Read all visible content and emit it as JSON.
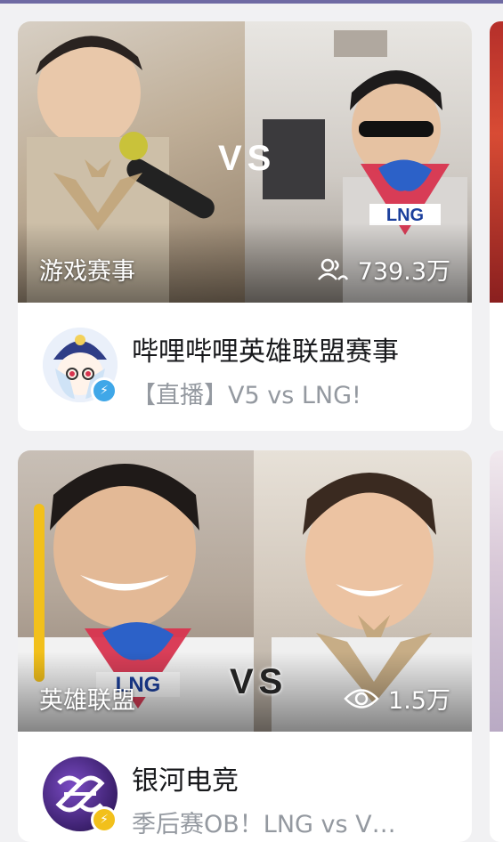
{
  "cards": [
    {
      "category": "游戏赛事",
      "viewers": "739.3万",
      "vs_text": "VS",
      "title": "哔哩哔哩英雄联盟赛事",
      "subtitle": "【直播】V5 vs LNG!",
      "viewer_icon": "people-icon",
      "badge_icon": "lightning-icon",
      "badge_color": "#3fa7e8"
    },
    {
      "category": "英雄联盟",
      "viewers": "1.5万",
      "vs_text": "VS",
      "title": "银河电竞",
      "subtitle": "季后赛OB！LNG vs V…",
      "viewer_icon": "eye-icon",
      "badge_icon": "lightning-icon",
      "badge_color": "#f2c01b"
    }
  ],
  "colors": {
    "accent_bar": "#6f6aa3",
    "background": "#f1f1f3"
  }
}
